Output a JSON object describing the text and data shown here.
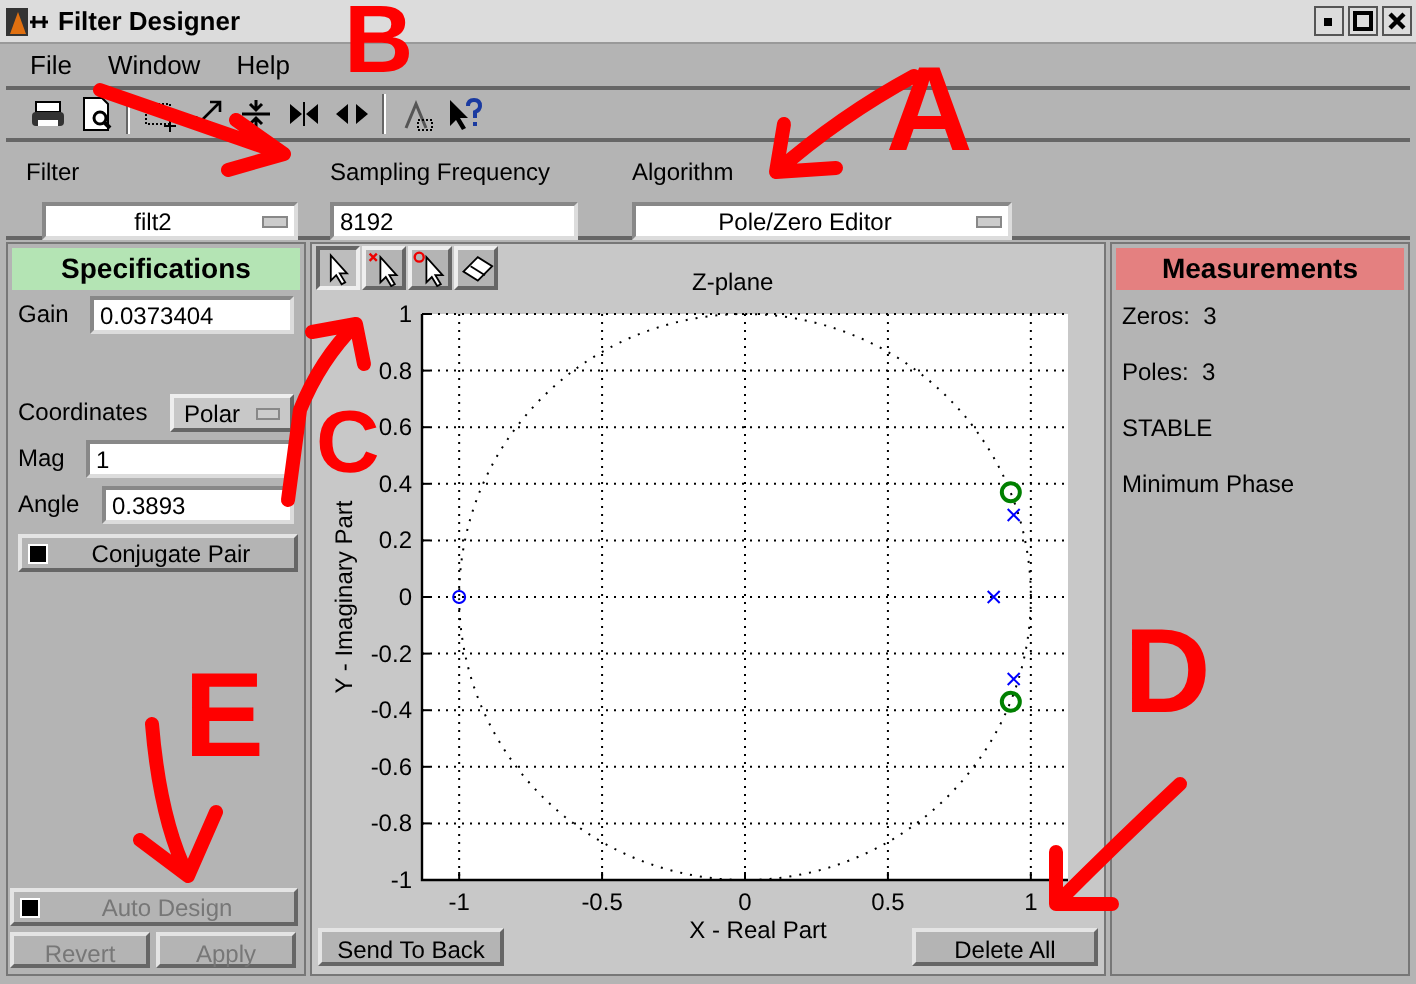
{
  "window": {
    "title": "Filter Designer"
  },
  "menu": [
    "File",
    "Window",
    "Help"
  ],
  "top_fields": [
    {
      "label": "Filter",
      "value": "filt2",
      "kind": "popup"
    },
    {
      "label": "Sampling Frequency",
      "value": "8192",
      "kind": "edit"
    },
    {
      "label": "Algorithm",
      "value": "Pole/Zero Editor",
      "kind": "popup"
    }
  ],
  "specifications": {
    "title": "Specifications",
    "fields": [
      {
        "label": "Gain",
        "value": "0.0373404",
        "kind": "edit"
      },
      {
        "label": "Coordinates",
        "value": "Polar",
        "kind": "popup"
      },
      {
        "label": "Mag",
        "value": "1",
        "kind": "edit"
      },
      {
        "label": "Angle",
        "value": "0.3893",
        "kind": "edit"
      }
    ],
    "conjugate_pair": {
      "label": "Conjugate Pair",
      "disabled": false
    },
    "auto_design": {
      "label": "Auto Design",
      "disabled": true
    },
    "buttons": [
      {
        "label": "Revert",
        "disabled": true
      },
      {
        "label": "Apply",
        "disabled": true
      }
    ]
  },
  "plot": {
    "tools": [
      {
        "kind": "select",
        "selected": true
      },
      {
        "kind": "add-pole",
        "selected": false
      },
      {
        "kind": "add-zero",
        "selected": false
      },
      {
        "kind": "eraser",
        "selected": false
      }
    ],
    "chart_data": {
      "type": "scatter",
      "title": "Z-plane",
      "xlabel": "X - Real Part",
      "ylabel": "Y - Imaginary Part",
      "grid": true,
      "xlim": [
        -1.13,
        1.13
      ],
      "ylim": [
        -1,
        1
      ],
      "xticks": [
        -1,
        -0.5,
        0,
        0.5,
        1
      ],
      "yticks": [
        -1,
        -0.8,
        -0.6,
        -0.4,
        -0.2,
        0,
        0.2,
        0.4,
        0.6,
        0.8,
        1
      ],
      "series": [
        {
          "color": "#0000ff",
          "x": [
            -1
          ],
          "values": [
            0
          ]
        },
        {
          "color": "#008000",
          "x": [
            0.93,
            0.93
          ],
          "values": [
            0.37,
            -0.37
          ]
        },
        {
          "color": "#0000ff",
          "x": [
            0.87,
            0.94,
            0.94
          ],
          "values": [
            0,
            0.29,
            -0.29
          ]
        }
      ]
    },
    "buttons": [
      "Send To Back",
      "Delete All"
    ]
  },
  "measurements": {
    "title": "Measurements",
    "items": [
      "Zeros:  3",
      "Poles:  3",
      "STABLE",
      "Minimum Phase"
    ]
  },
  "annotations": [
    {
      "label": "A"
    },
    {
      "label": "B"
    },
    {
      "label": "C"
    },
    {
      "label": "D"
    },
    {
      "label": "E"
    }
  ]
}
